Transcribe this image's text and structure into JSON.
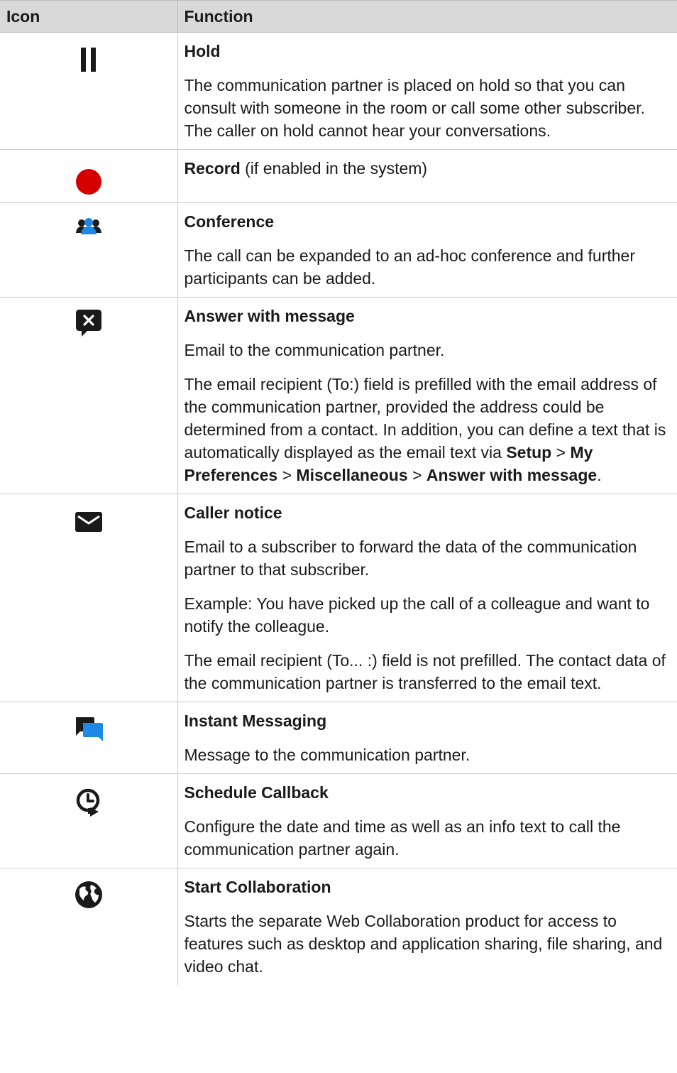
{
  "header": {
    "icon": "Icon",
    "function": "Function"
  },
  "rows": [
    {
      "icon": "pause-icon",
      "title": "Hold",
      "paras": [
        "The communication partner is placed on hold so that you can consult with someone in the room or call some other subscriber. The caller on hold cannot hear your conversations."
      ]
    },
    {
      "icon": "record-icon",
      "title": "Record",
      "title_suffix": " (if enabled in the system)",
      "paras": []
    },
    {
      "icon": "conference-icon",
      "title": "Conference",
      "paras": [
        "The call can be expanded to an ad-hoc conference and further participants can be added."
      ]
    },
    {
      "icon": "answer-with-message-icon",
      "title": "Answer with message",
      "paras": [
        "Email to the communication partner.",
        "The email recipient (To:) field is prefilled with the email address of the communication partner, provided the address could be determined from a contact. In addition, you can define a text that is automatically displayed as the email text via"
      ],
      "path": [
        "Setup",
        ">",
        "My Preferences",
        ">",
        "Miscellaneous",
        ">",
        "Answer with message",
        "."
      ]
    },
    {
      "icon": "envelope-icon",
      "title": "Caller notice",
      "paras": [
        "Email to a subscriber to forward the data of the communication partner to that subscriber.",
        "Example: You have picked up the call of a colleague and want to notify the colleague.",
        "The email recipient (To... :) field is not prefilled. The contact data of the communication partner is transferred to the email text."
      ]
    },
    {
      "icon": "chat-bubbles-icon",
      "title": "Instant Messaging",
      "paras": [
        "Message to the communication partner."
      ]
    },
    {
      "icon": "schedule-callback-icon",
      "title": "Schedule Callback",
      "paras": [
        "Configure the date and time as well as an info text to call the communication partner again."
      ]
    },
    {
      "icon": "globe-icon",
      "title": "Start Collaboration",
      "paras": [
        "Starts the separate Web Collaboration product for access to features such as desktop and application sharing, file sharing, and video chat."
      ]
    }
  ],
  "colors": {
    "record": "#d40000",
    "conference": "#1e88e5",
    "chat": "#1e88e5",
    "dark": "#1a1a1a",
    "header_bg": "#d9d9d9"
  }
}
